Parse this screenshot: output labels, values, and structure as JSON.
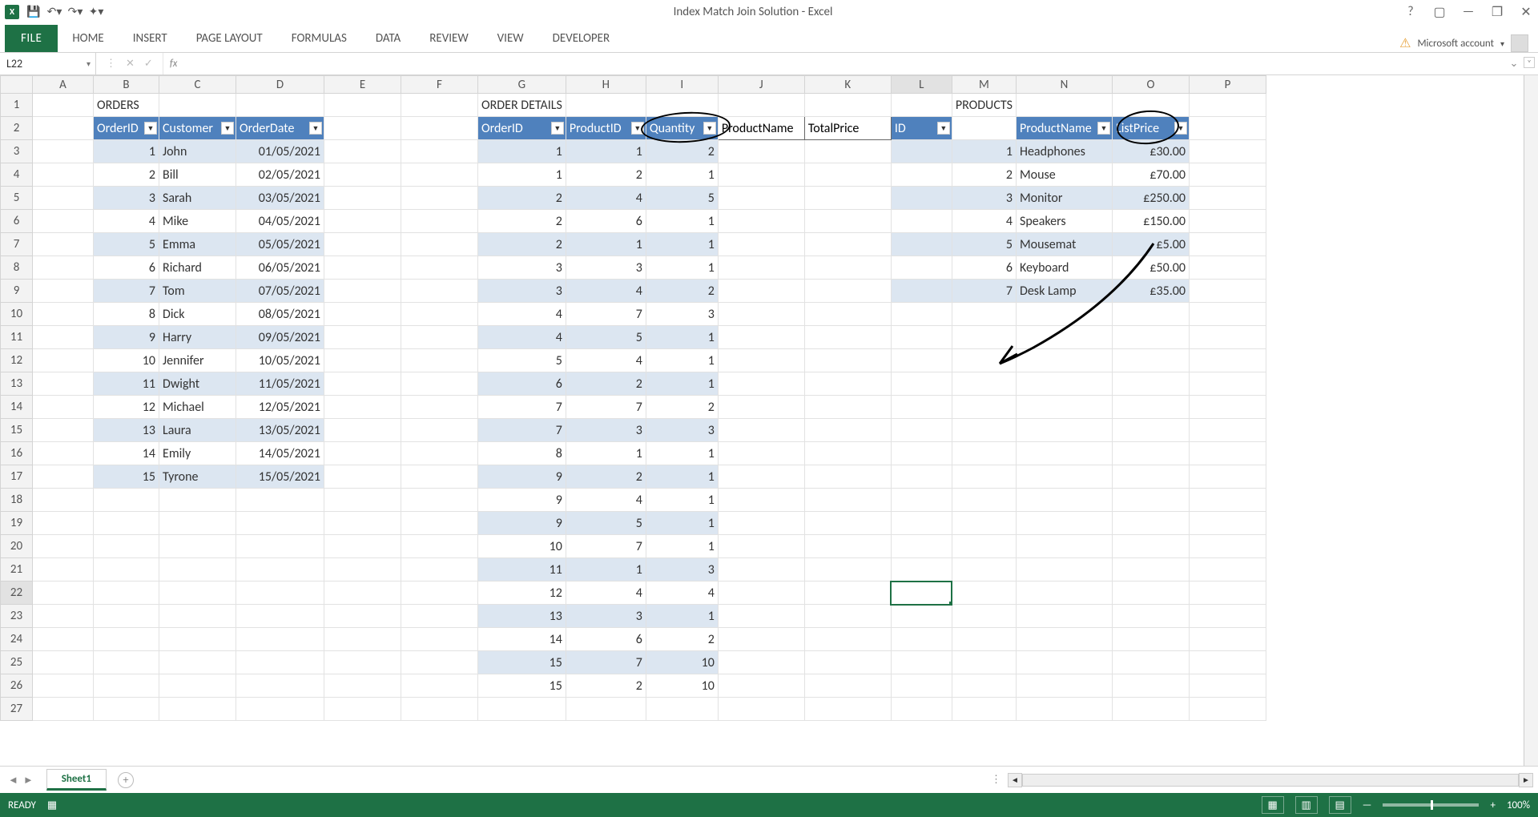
{
  "title": "Index Match Join Solution - Excel",
  "account_label": "Microsoft account",
  "ribbon": {
    "file": "FILE",
    "tabs": [
      "HOME",
      "INSERT",
      "PAGE LAYOUT",
      "FORMULAS",
      "DATA",
      "REVIEW",
      "VIEW",
      "DEVELOPER"
    ]
  },
  "namebox": "L22",
  "fx": "",
  "columns": [
    "A",
    "B",
    "C",
    "D",
    "E",
    "F",
    "G",
    "H",
    "I",
    "J",
    "K",
    "L",
    "M",
    "N",
    "O",
    "P"
  ],
  "row_count": 27,
  "labels": {
    "orders": "ORDERS",
    "details": "ORDER DETAILS",
    "products": "PRODUCTS",
    "j2": "ProductName",
    "k2": "TotalPrice"
  },
  "orders": {
    "headers": [
      "OrderID",
      "Customer",
      "OrderDate"
    ],
    "rows": [
      {
        "id": 1,
        "cust": "John",
        "date": "01/05/2021"
      },
      {
        "id": 2,
        "cust": "Bill",
        "date": "02/05/2021"
      },
      {
        "id": 3,
        "cust": "Sarah",
        "date": "03/05/2021"
      },
      {
        "id": 4,
        "cust": "Mike",
        "date": "04/05/2021"
      },
      {
        "id": 5,
        "cust": "Emma",
        "date": "05/05/2021"
      },
      {
        "id": 6,
        "cust": "Richard",
        "date": "06/05/2021"
      },
      {
        "id": 7,
        "cust": "Tom",
        "date": "07/05/2021"
      },
      {
        "id": 8,
        "cust": "Dick",
        "date": "08/05/2021"
      },
      {
        "id": 9,
        "cust": "Harry",
        "date": "09/05/2021"
      },
      {
        "id": 10,
        "cust": "Jennifer",
        "date": "10/05/2021"
      },
      {
        "id": 11,
        "cust": "Dwight",
        "date": "11/05/2021"
      },
      {
        "id": 12,
        "cust": "Michael",
        "date": "12/05/2021"
      },
      {
        "id": 13,
        "cust": "Laura",
        "date": "13/05/2021"
      },
      {
        "id": 14,
        "cust": "Emily",
        "date": "14/05/2021"
      },
      {
        "id": 15,
        "cust": "Tyrone",
        "date": "15/05/2021"
      }
    ]
  },
  "details": {
    "headers": [
      "OrderID",
      "ProductID",
      "Quantity"
    ],
    "rows": [
      {
        "oid": 1,
        "pid": 1,
        "qty": 2
      },
      {
        "oid": 1,
        "pid": 2,
        "qty": 1
      },
      {
        "oid": 2,
        "pid": 4,
        "qty": 5
      },
      {
        "oid": 2,
        "pid": 6,
        "qty": 1
      },
      {
        "oid": 2,
        "pid": 1,
        "qty": 1
      },
      {
        "oid": 3,
        "pid": 3,
        "qty": 1
      },
      {
        "oid": 3,
        "pid": 4,
        "qty": 2
      },
      {
        "oid": 4,
        "pid": 7,
        "qty": 3
      },
      {
        "oid": 4,
        "pid": 5,
        "qty": 1
      },
      {
        "oid": 5,
        "pid": 4,
        "qty": 1
      },
      {
        "oid": 6,
        "pid": 2,
        "qty": 1
      },
      {
        "oid": 7,
        "pid": 7,
        "qty": 2
      },
      {
        "oid": 7,
        "pid": 3,
        "qty": 3
      },
      {
        "oid": 8,
        "pid": 1,
        "qty": 1
      },
      {
        "oid": 9,
        "pid": 2,
        "qty": 1
      },
      {
        "oid": 9,
        "pid": 4,
        "qty": 1
      },
      {
        "oid": 9,
        "pid": 5,
        "qty": 1
      },
      {
        "oid": 10,
        "pid": 7,
        "qty": 1
      },
      {
        "oid": 11,
        "pid": 1,
        "qty": 3
      },
      {
        "oid": 12,
        "pid": 4,
        "qty": 4
      },
      {
        "oid": 13,
        "pid": 3,
        "qty": 1
      },
      {
        "oid": 14,
        "pid": 6,
        "qty": 2
      },
      {
        "oid": 15,
        "pid": 7,
        "qty": 10
      },
      {
        "oid": 15,
        "pid": 2,
        "qty": 10
      }
    ]
  },
  "products": {
    "headers": [
      "ID",
      "ProductName",
      "ListPrice"
    ],
    "rows": [
      {
        "id": 1,
        "name": "Headphones",
        "price": "£30.00"
      },
      {
        "id": 2,
        "name": "Mouse",
        "price": "£70.00"
      },
      {
        "id": 3,
        "name": "Monitor",
        "price": "£250.00"
      },
      {
        "id": 4,
        "name": "Speakers",
        "price": "£150.00"
      },
      {
        "id": 5,
        "name": "Mousemat",
        "price": "£5.00"
      },
      {
        "id": 6,
        "name": "Keyboard",
        "price": "£50.00"
      },
      {
        "id": 7,
        "name": "Desk Lamp",
        "price": "£35.00"
      }
    ]
  },
  "sheet": "Sheet1",
  "status": "READY",
  "zoom": "100%",
  "selected_cell": {
    "row": 22,
    "col": "L"
  }
}
